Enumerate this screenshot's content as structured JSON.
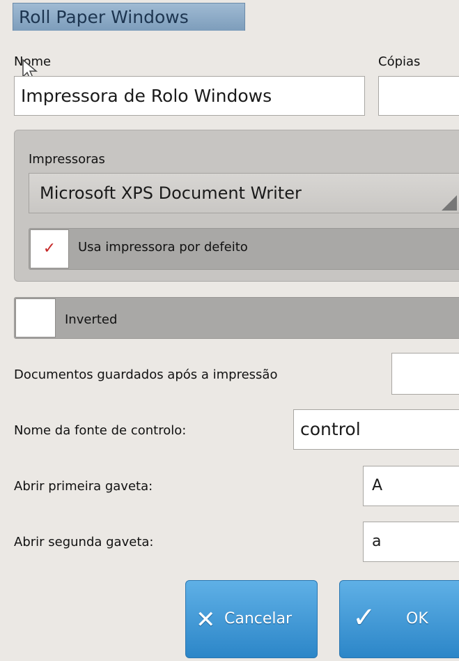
{
  "window": {
    "title": "Roll Paper Windows"
  },
  "form": {
    "name_label": "Nome",
    "name_value": "Impressora de Rolo Windows",
    "copies_label": "Cópias",
    "copies_value": "",
    "printers_label": "Impressoras",
    "printer_selected": "Microsoft XPS Document Writer",
    "use_default_label": "Usa impressora por defeito",
    "use_default_checked": true,
    "check_mark": "✓",
    "inverted_label": "Inverted",
    "inverted_checked": false,
    "saved_docs_label": "Documentos guardados após a impressão",
    "saved_docs_value": "",
    "control_font_label": "Nome da fonte de controlo:",
    "control_font_value": "control",
    "drawer1_label": "Abrir primeira gaveta:",
    "drawer1_value": "A",
    "drawer2_label": "Abrir segunda gaveta:",
    "drawer2_value": "a"
  },
  "buttons": {
    "cancel_label": "Cancelar",
    "cancel_icon": "✕",
    "ok_label": "OK",
    "ok_icon": "✓"
  },
  "colors": {
    "accent": "#3a96d6",
    "title_tab": "#8fabc7",
    "check": "#c62828"
  }
}
